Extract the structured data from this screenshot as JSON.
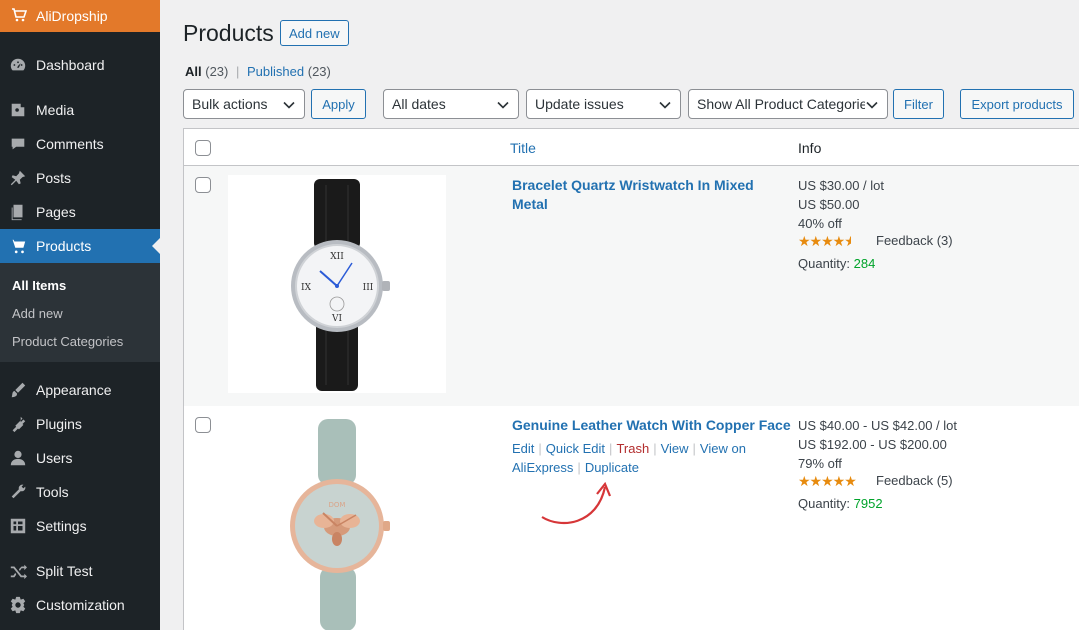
{
  "sidebar": {
    "brand": "AliDropship",
    "items": [
      {
        "label": "Dashboard",
        "icon": "dashboard-icon"
      },
      {
        "label": "Media",
        "icon": "media-icon"
      },
      {
        "label": "Comments",
        "icon": "comments-icon"
      },
      {
        "label": "Posts",
        "icon": "posts-icon"
      },
      {
        "label": "Pages",
        "icon": "pages-icon"
      },
      {
        "label": "Products",
        "icon": "cart-icon"
      },
      {
        "label": "Appearance",
        "icon": "brush-icon"
      },
      {
        "label": "Plugins",
        "icon": "plugin-icon"
      },
      {
        "label": "Users",
        "icon": "users-icon"
      },
      {
        "label": "Tools",
        "icon": "wrench-icon"
      },
      {
        "label": "Settings",
        "icon": "settings-icon"
      },
      {
        "label": "Split Test",
        "icon": "shuffle-icon"
      },
      {
        "label": "Customization",
        "icon": "gear-icon"
      }
    ],
    "submenu": [
      "All Items",
      "Add new",
      "Product Categories"
    ]
  },
  "header": {
    "title": "Products",
    "add_new": "Add new"
  },
  "views": {
    "all": "All",
    "all_count": "(23)",
    "sep": "|",
    "published": "Published",
    "published_count": "(23)"
  },
  "toolbar": {
    "bulk": "Bulk actions",
    "apply": "Apply",
    "dates": "All dates",
    "issues": "Update issues",
    "categories": "Show All Product Categories",
    "filter": "Filter",
    "export": "Export products"
  },
  "table": {
    "col_title": "Title",
    "col_info": "Info",
    "rows": [
      {
        "title_line1": "Bracelet Quartz Wristwatch In Mixed",
        "title_line2": "Metal",
        "price": "US $30.00 / lot",
        "old_price": "US $50.00",
        "discount": "40% off",
        "feedback": "Feedback (3)",
        "qty_label": "Quantity:",
        "qty": "284",
        "rating": 4.5
      },
      {
        "title": "Genuine Leather Watch With Copper Face",
        "price": "US $40.00 - US $42.00 / lot",
        "old_price": "US $192.00 - US $200.00",
        "discount": "79% off",
        "feedback": "Feedback (5)",
        "qty_label": "Quantity:",
        "qty": "7952",
        "rating": 5,
        "actions": {
          "edit": "Edit",
          "quick_edit": "Quick Edit",
          "trash": "Trash",
          "view": "View",
          "view_on": "View on",
          "aliexpress": "AliExpress",
          "duplicate": "Duplicate",
          "sep": "|"
        }
      }
    ]
  },
  "colors": {
    "accent": "#2271b1",
    "brand": "#e3792a",
    "sidebar": "#1d2327",
    "star": "#e78b0f",
    "qty": "#00a32a",
    "trash": "#b32d2e",
    "annotation": "#d63638"
  }
}
